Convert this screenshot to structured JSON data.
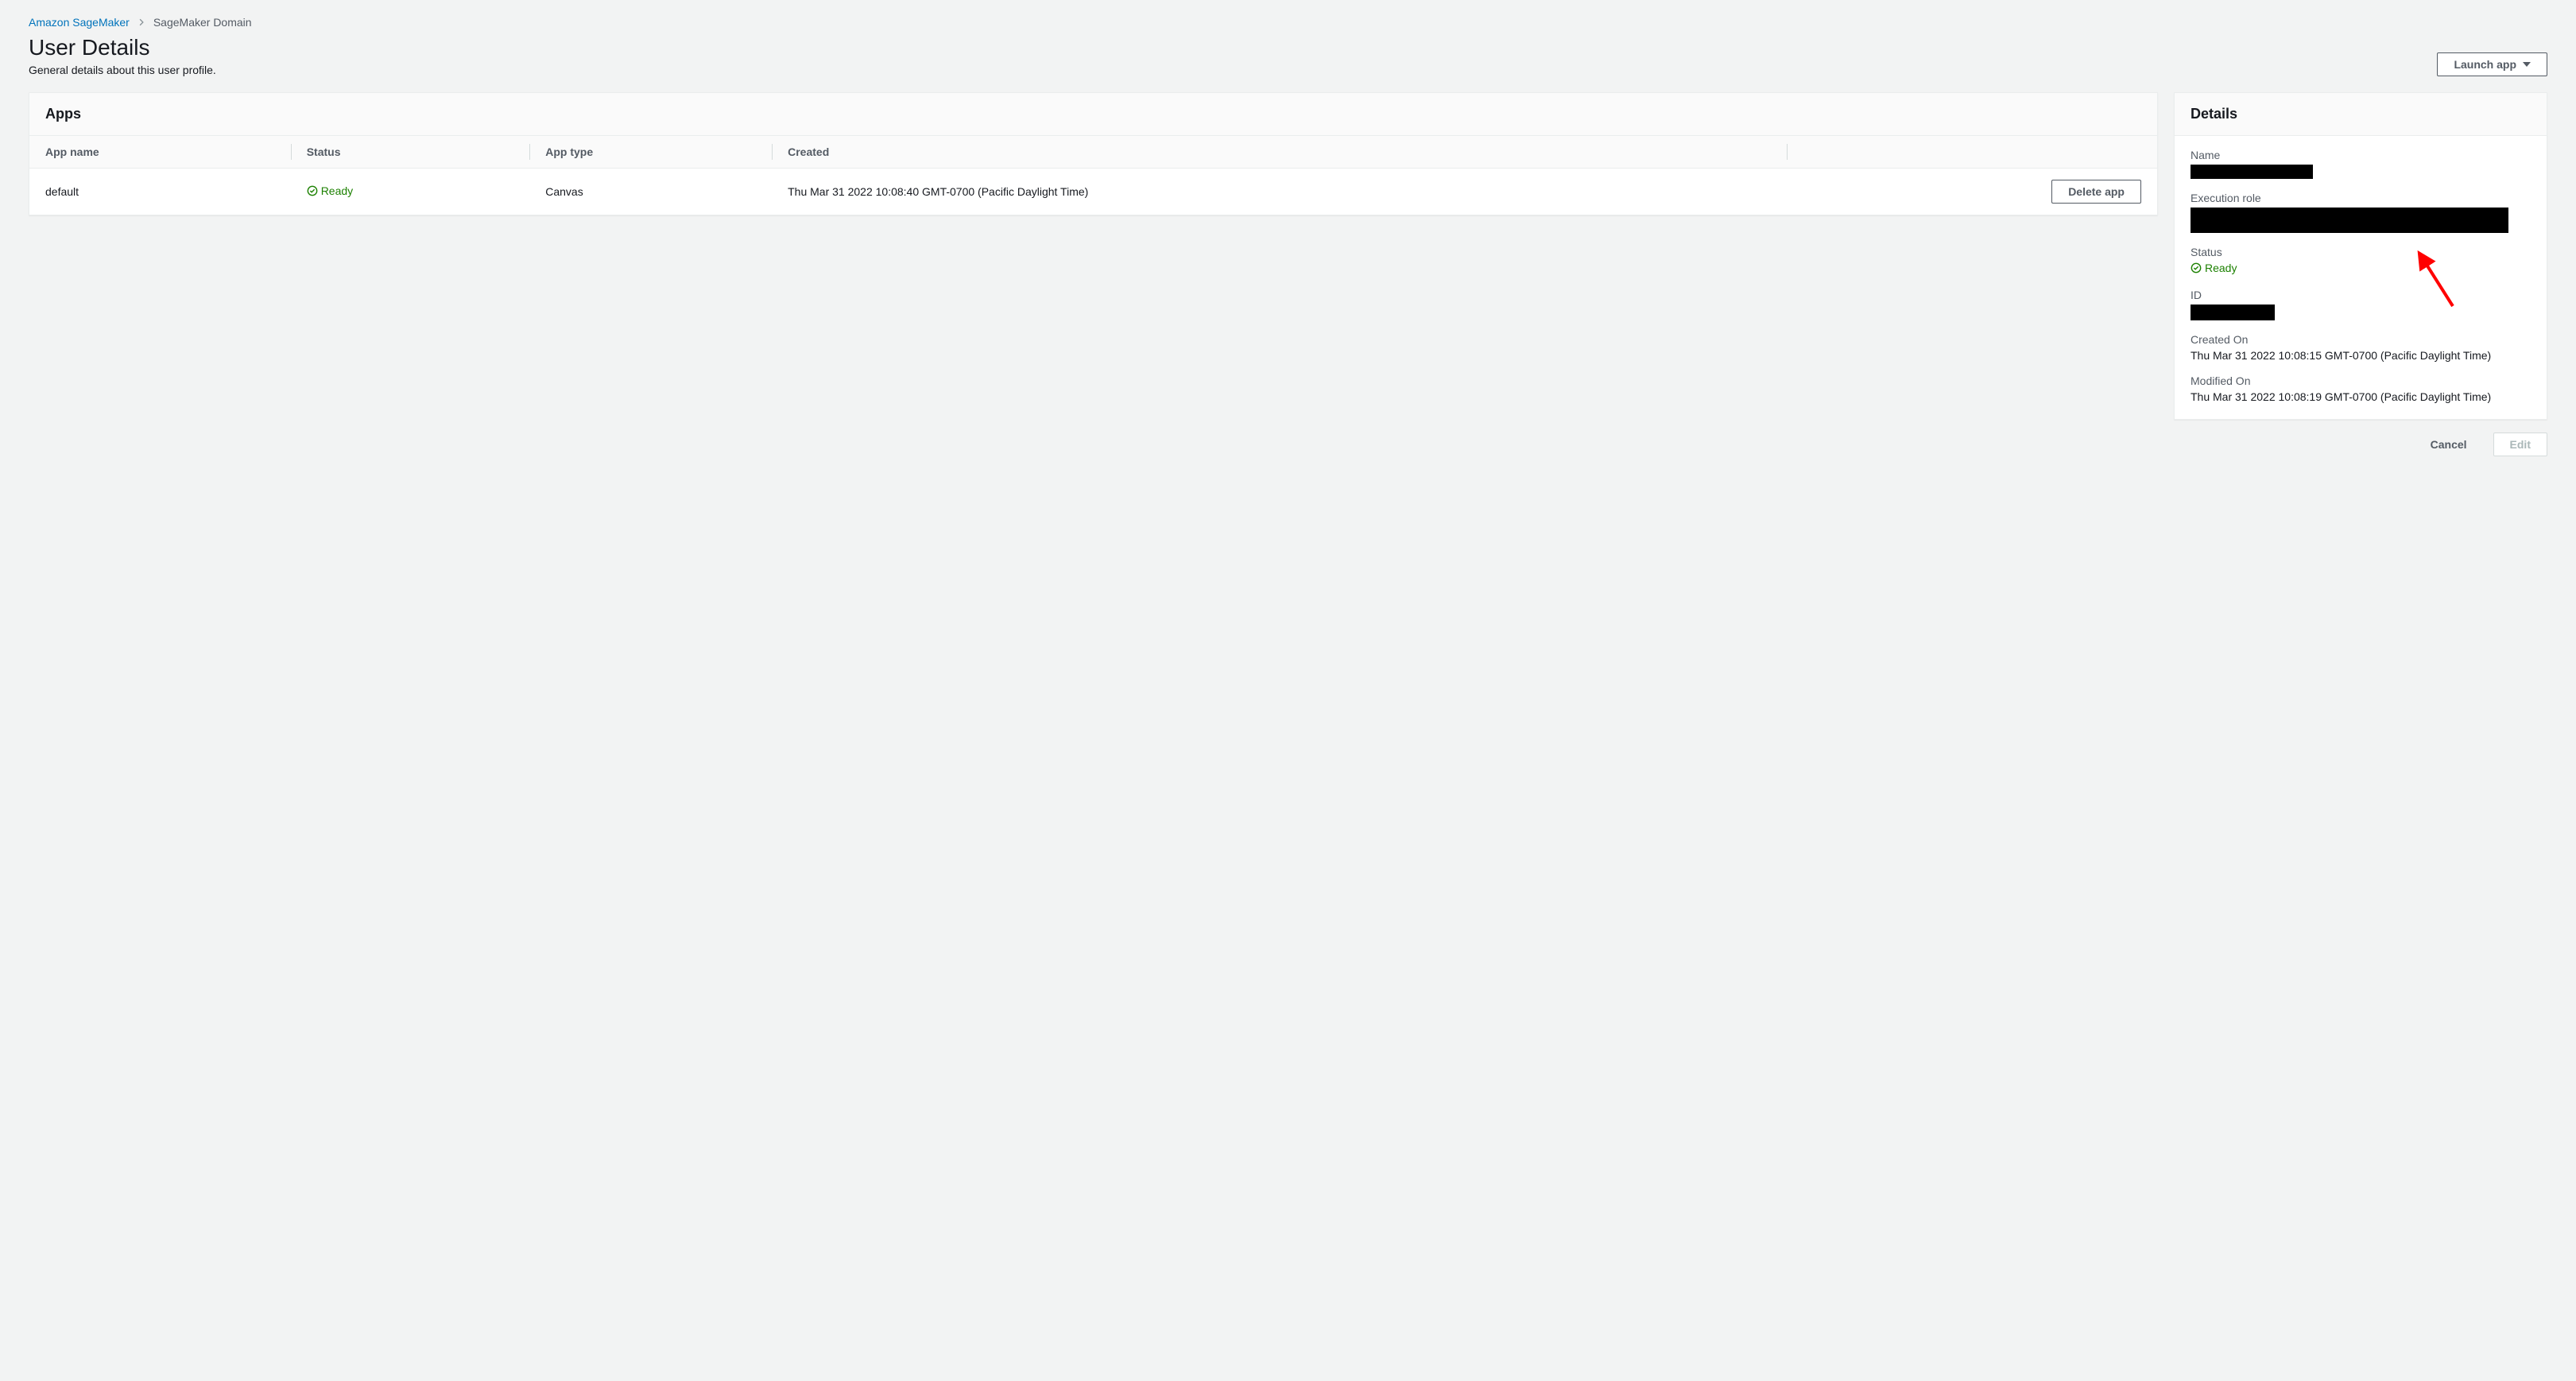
{
  "breadcrumb": {
    "root": "Amazon SageMaker",
    "current": "SageMaker Domain"
  },
  "header": {
    "title": "User Details",
    "subtitle": "General details about this user profile.",
    "launch_label": "Launch app"
  },
  "apps_panel": {
    "title": "Apps",
    "columns": {
      "app_name": "App name",
      "status": "Status",
      "app_type": "App type",
      "created": "Created"
    },
    "rows": [
      {
        "app_name": "default",
        "status": "Ready",
        "app_type": "Canvas",
        "created": "Thu Mar 31 2022 10:08:40 GMT-0700 (Pacific Daylight Time)",
        "action": "Delete app"
      }
    ]
  },
  "details_panel": {
    "title": "Details",
    "labels": {
      "name": "Name",
      "execution_role": "Execution role",
      "status": "Status",
      "id": "ID",
      "created_on": "Created On",
      "modified_on": "Modified On"
    },
    "values": {
      "status": "Ready",
      "created_on": "Thu Mar 31 2022 10:08:15 GMT-0700 (Pacific Daylight Time)",
      "modified_on": "Thu Mar 31 2022 10:08:19 GMT-0700 (Pacific Daylight Time)"
    }
  },
  "footer": {
    "cancel": "Cancel",
    "edit": "Edit"
  }
}
